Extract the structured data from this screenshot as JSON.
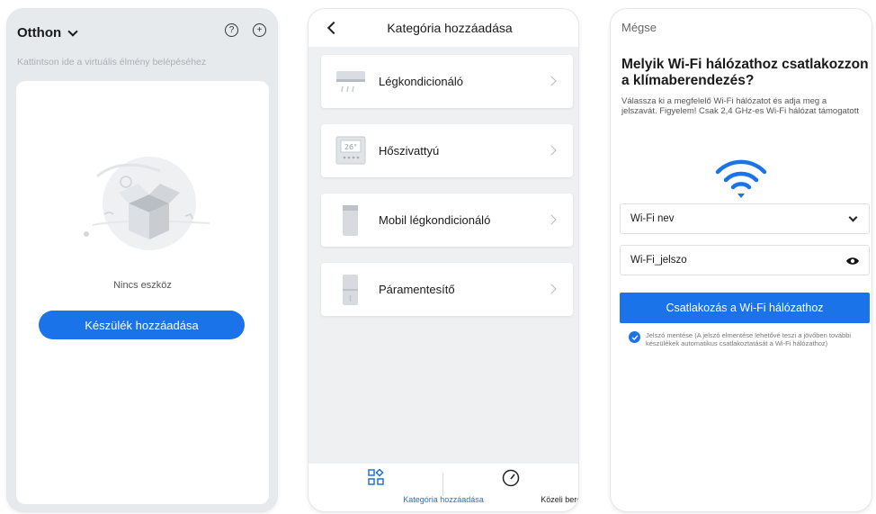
{
  "screen1": {
    "home_title": "Otthon",
    "help_icon": "question-circle-icon",
    "add_icon": "plus-circle-icon",
    "virtual_hint": "Kattintson ide a virtuális élmény belépéséhez",
    "empty_text": "Nincs eszköz",
    "add_device_label": "Készülék hozzáadása",
    "accent": "#1a73e8"
  },
  "screen2": {
    "title": "Kategória hozzáadása",
    "categories": [
      {
        "label": "Légkondicionáló",
        "icon": "air-conditioner-icon"
      },
      {
        "label": "Hőszivattyú",
        "icon": "heat-pump-icon",
        "display": "26°"
      },
      {
        "label": "Mobil légkondicionáló",
        "icon": "portable-ac-icon"
      },
      {
        "label": "Páramentesítő",
        "icon": "dehumidifier-icon"
      }
    ],
    "tabs": [
      {
        "label": "Kategória hozzáadása",
        "icon": "grid-add-icon",
        "active": true
      },
      {
        "label": "Közeli berendezések",
        "icon": "gauge-icon",
        "active": false
      }
    ]
  },
  "screen3": {
    "cancel": "Mégse",
    "title": "Melyik Wi-Fi hálózathoz csatlakozzon a klímaberendezés?",
    "description": "Válassza ki a megfelelő Wi-Fi hálózatot és adja meg a jelszavát. Figyelem! Csak 2,4 GHz-es Wi-Fi hálózat támogatott",
    "ssid_value": "Wi-Fi nev",
    "password_value": "Wi-Fi_jelszo",
    "connect_label": "Csatlakozás a Wi-Fi hálózathoz",
    "save_password_text": "Jelszó mentése (A jelszó elmentése lehetővé teszi a jövőben további készülékek automatikus csatlakoztatását a Wi-Fi hálózathoz)",
    "save_password_checked": true
  }
}
